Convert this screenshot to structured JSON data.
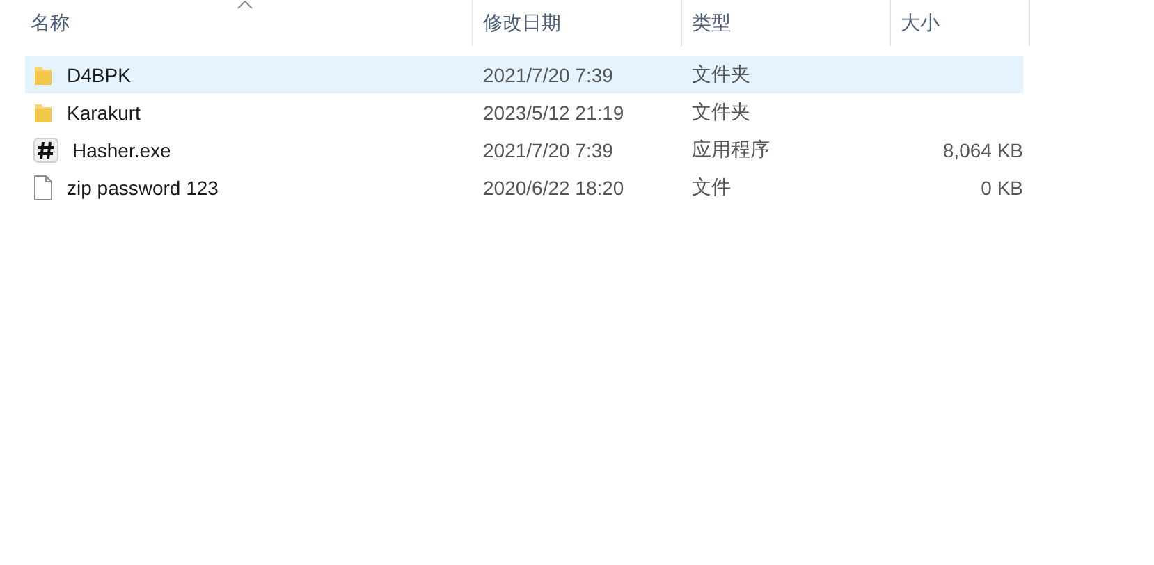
{
  "columns": [
    {
      "label": "名称",
      "sorted": true
    },
    {
      "label": "修改日期",
      "sorted": false
    },
    {
      "label": "类型",
      "sorted": false
    },
    {
      "label": "大小",
      "sorted": false
    }
  ],
  "rows": [
    {
      "kind": "folder",
      "name": "D4BPK",
      "modified": "2021/7/20 7:39",
      "type": "文件夹",
      "selected": true
    },
    {
      "kind": "folder",
      "name": "Karakurt",
      "modified": "2023/5/12 21:19",
      "type": "文件夹",
      "selected": false
    },
    {
      "kind": "exe",
      "name": "Hasher.exe",
      "modified": "2021/7/20 7:39",
      "type": "应用程序",
      "size": "8,064 KB",
      "selected": false
    },
    {
      "kind": "file",
      "name": "zip password 123",
      "modified": "2020/6/22 18:20",
      "type": "文件",
      "size": "0 KB",
      "selected": false
    }
  ]
}
